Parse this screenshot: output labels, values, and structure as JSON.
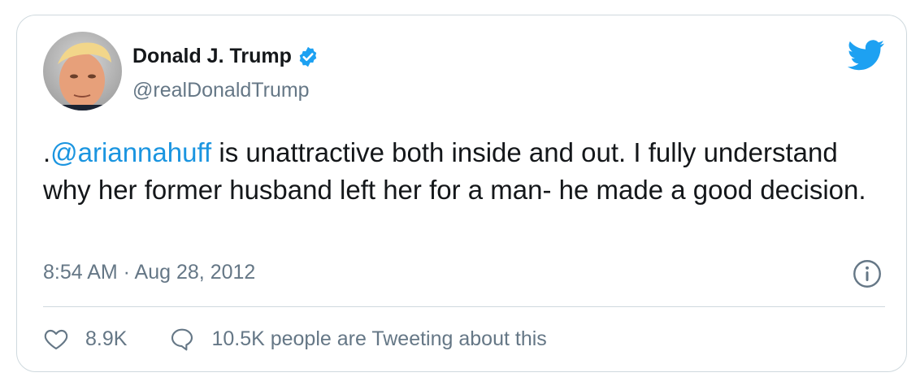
{
  "tweet": {
    "author": {
      "name": "Donald J. Trump",
      "handle": "@realDonaldTrump",
      "verified": true,
      "avatar_icon": "profile-photo"
    },
    "text_prefix": ".",
    "mention": "@ariannahuff",
    "text_body": " is unattractive both inside and out. I fully understand why her former husband left her for a man- he made a good decision.",
    "timestamp": "8:54 AM · Aug 28, 2012",
    "likes": "8.9K",
    "reply_text": "10.5K people are Tweeting about this",
    "colors": {
      "link": "#1b95e0",
      "text": "#14171a",
      "muted": "#657786",
      "border": "#cfd9de"
    },
    "icons": [
      "twitter-bird-icon",
      "verified-badge-icon",
      "info-icon",
      "heart-icon",
      "reply-bubble-icon"
    ]
  }
}
